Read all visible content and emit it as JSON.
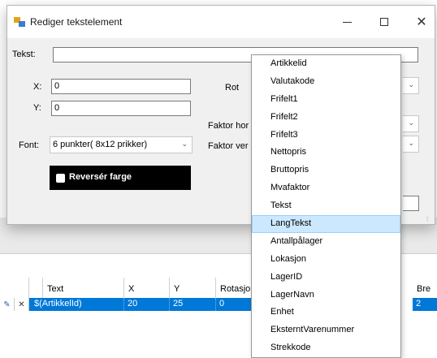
{
  "dialog": {
    "title": "Rediger tekstelement",
    "minimize": "–",
    "close": "✕",
    "tekst": {
      "label": "Tekst:",
      "value": ""
    },
    "x": {
      "label": "X:",
      "value": "0"
    },
    "y": {
      "label": "Y:",
      "value": "0"
    },
    "font": {
      "label": "Font:",
      "value": "6 punkter( 8x12 prikker)"
    },
    "rotation_label": "Rot",
    "faktor_hor_label": "Faktor hor",
    "faktor_ver_label": "Faktor ver",
    "reverse_label": "Reversér farge"
  },
  "dropdown": {
    "items": [
      "Artikkelid",
      "Valutakode",
      "Frifelt1",
      "Frifelt2",
      "Frifelt3",
      "Nettopris",
      "Bruttopris",
      "Mvafaktor",
      "Tekst",
      "LangTekst",
      "Antallpålager",
      "Lokasjon",
      "LagerID",
      "LagerNavn",
      "Enhet",
      "EksterntVarenummer",
      "Strekkode"
    ],
    "selected": "LangTekst"
  },
  "grid": {
    "headers": {
      "text": "Text",
      "x": "X",
      "y": "Y",
      "rotation": "Rotasjo",
      "bre": "Bre"
    },
    "row": {
      "edit_icon": "✎",
      "delete_icon": "✕",
      "text": "$(ArtikkelId)",
      "x": "20",
      "y": "25",
      "rotation": "0",
      "bre": "2"
    }
  }
}
